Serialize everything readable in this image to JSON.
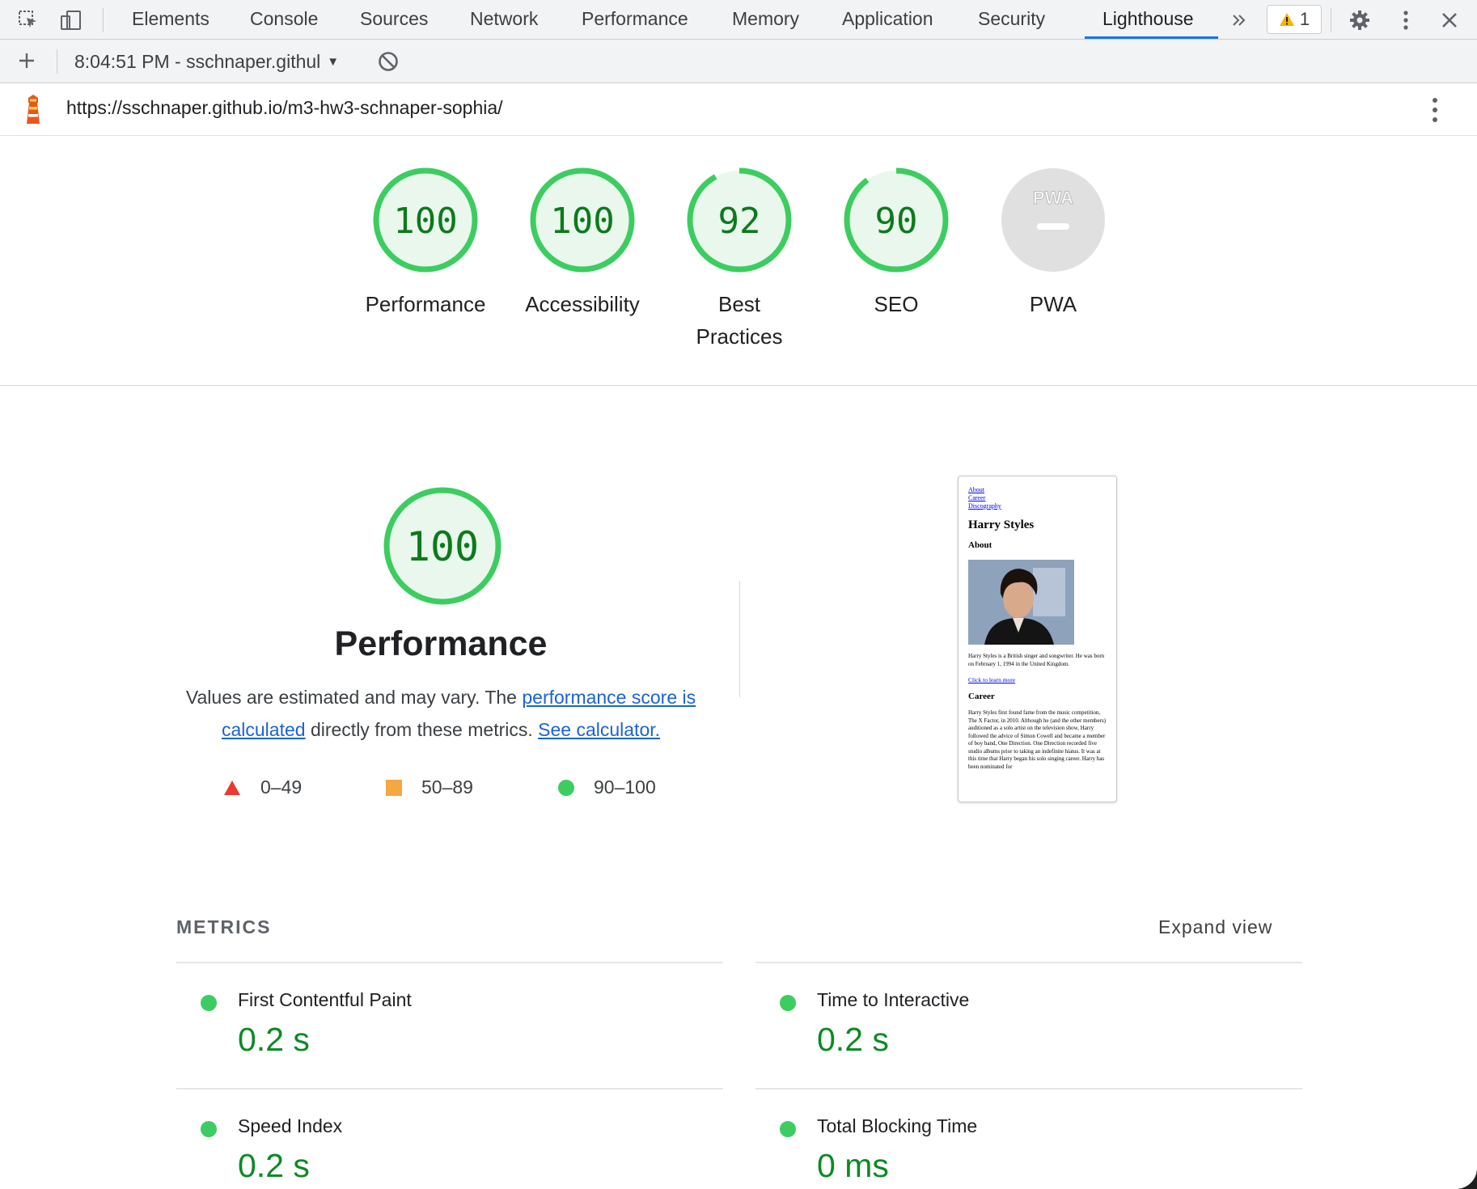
{
  "devtools": {
    "tabs": [
      "Elements",
      "Console",
      "Sources",
      "Network",
      "Performance",
      "Memory",
      "Application",
      "Security",
      "Lighthouse"
    ],
    "active_tab": "Lighthouse",
    "more_tabs_icon": "double-chevron-right-icon",
    "warning_count": "1"
  },
  "toolbar": {
    "report_label": "8:04:51 PM - sschnaper.githul"
  },
  "urlbar": {
    "url": "https://sschnaper.github.io/m3-hw3-schnaper-sophia/"
  },
  "gauges": [
    {
      "score": "100",
      "label": "Performance"
    },
    {
      "score": "100",
      "label": "Accessibility"
    },
    {
      "score": "92",
      "label": "Best Practices"
    },
    {
      "score": "90",
      "label": "SEO"
    },
    {
      "score": "",
      "label": "PWA",
      "badge": "PWA"
    }
  ],
  "performance": {
    "score": "100",
    "title": "Performance",
    "desc_prefix": "Values are estimated and may vary. The ",
    "desc_link1": "performance score is calculated",
    "desc_middle": " directly from these metrics. ",
    "desc_link2": "See calculator.",
    "legend": [
      {
        "range": "0–49",
        "shape": "triangle",
        "color": "#eb3a2f"
      },
      {
        "range": "50–89",
        "shape": "square",
        "color": "#f5a742"
      },
      {
        "range": "90–100",
        "shape": "circle",
        "color": "#3ccd60"
      }
    ]
  },
  "thumbnail": {
    "links": [
      "About",
      "Career",
      "Discography"
    ],
    "heading": "Harry Styles",
    "about_heading": "About",
    "about_text": "Harry Styles is a British singer and songwriter. He was born on February 1, 1994 in the United Kingdom.",
    "learn_more": "Click to learn more",
    "career_heading": "Career",
    "career_text": "Harry Styles first found fame from the music competition, The X Factor, in 2010. Although he (and the other members) auditioned as a solo artist on the television show, Harry followed the advice of Simon Cowell and became a member of boy band, One Direction. One Direction recorded five studio albums prior to taking an indefinite hiatus. It was at this time that Harry began his solo singing career. Harry has been nominated for"
  },
  "metrics": {
    "title": "METRICS",
    "expand_label": "Expand view",
    "items": [
      {
        "label": "First Contentful Paint",
        "value": "0.2 s"
      },
      {
        "label": "Time to Interactive",
        "value": "0.2 s"
      },
      {
        "label": "Speed Index",
        "value": "0.2 s"
      },
      {
        "label": "Total Blocking Time",
        "value": "0 ms"
      }
    ]
  },
  "colors": {
    "pass_green": "#0c7a1c",
    "pass_ring": "#3ccd60",
    "pass_fill": "#e9f7ec",
    "link_blue": "#1a62d9",
    "active_tab_underline": "#1a73e8",
    "pwa_grey": "#e0e0e0"
  }
}
